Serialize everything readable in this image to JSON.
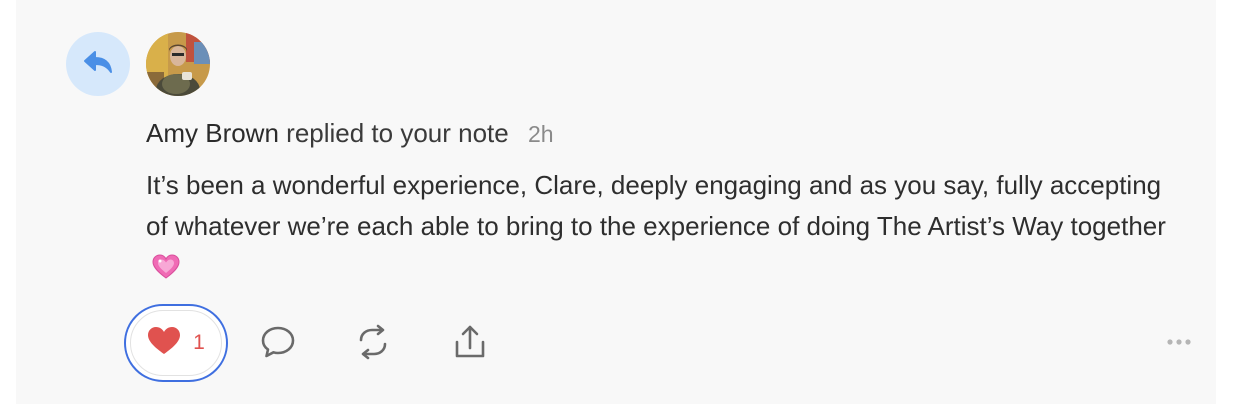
{
  "notification": {
    "type_icon": "reply-arrow-icon",
    "author": "Amy Brown",
    "action": "replied to your note",
    "time": "2h",
    "body": "It’s been a wonderful experience, Clare, deeply engaging and as you say, fully accepting of whatever we’re each able to bring to the experience of doing The Artist’s Way together",
    "body_emoji": "sparkling-heart-icon"
  },
  "actions": {
    "like_count": "1",
    "like_icon": "heart-icon",
    "comment_icon": "comment-bubble-icon",
    "restack_icon": "restack-icon",
    "share_icon": "share-icon",
    "more_icon": "more-horizontal-icon"
  },
  "colors": {
    "accent_blue": "#4a90e2",
    "like_red": "#e0524f",
    "focus_ring": "#3f6fe0"
  }
}
